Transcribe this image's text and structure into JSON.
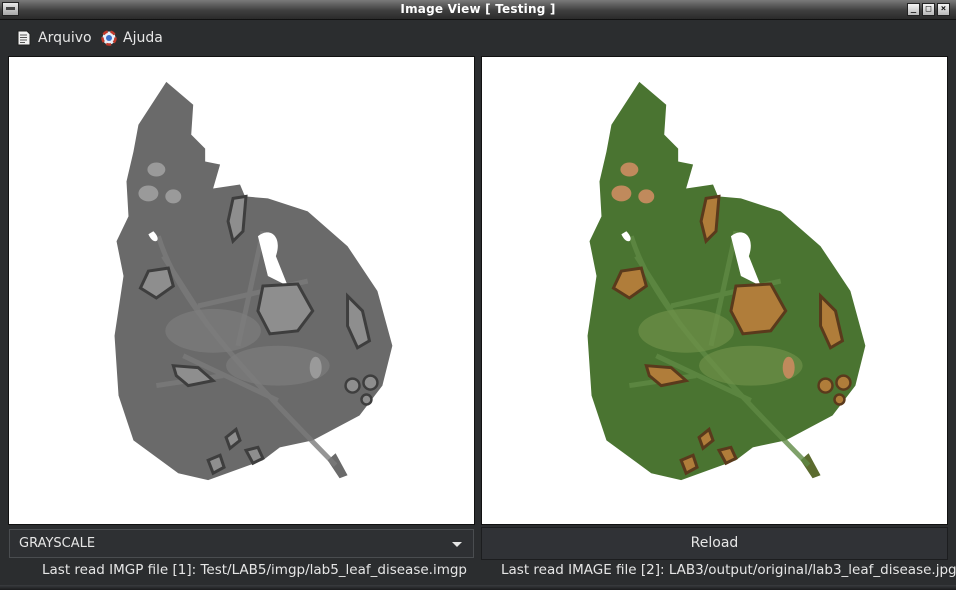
{
  "window": {
    "title": "Image View [ Testing ]"
  },
  "menu": [
    {
      "label": "Arquivo",
      "icon": "document-icon"
    },
    {
      "label": "Ajuda",
      "icon": "help-icon"
    }
  ],
  "left_panel": {
    "mode": "GRAYSCALE",
    "status": "Last read IMGP file [1]: Test/LAB5/imgp/lab5_leaf_disease.imgp"
  },
  "right_panel": {
    "reload_label": "Reload",
    "status": "Last read IMAGE file [2]: LAB3/output/original/lab3_leaf_disease.jpg"
  },
  "colors": {
    "gray_leaf": "#6a6a6a",
    "gray_vein": "#7a7a7a",
    "gray_lesion": "#8e8e8e",
    "gray_dark": "#3e3e3e",
    "color_leaf": "#4a7431",
    "color_vein": "#5f8a45",
    "color_lesion": "#b07d3a",
    "color_dark": "#5a3a1c"
  }
}
